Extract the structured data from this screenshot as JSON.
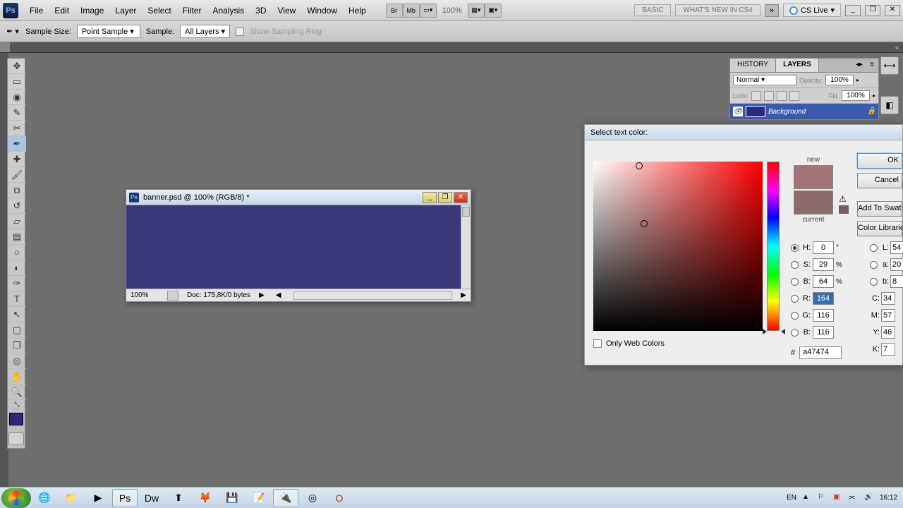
{
  "menubar": {
    "items": [
      "File",
      "Edit",
      "Image",
      "Layer",
      "Select",
      "Filter",
      "Analysis",
      "3D",
      "View",
      "Window",
      "Help"
    ],
    "zoom_pct": "100%",
    "workspace_basic": "BASIC",
    "workspace_whatsnew": "WHAT'S NEW IN CS4",
    "cslive": "CS Live"
  },
  "optbar": {
    "sample_size_label": "Sample Size:",
    "sample_size_value": "Point Sample",
    "sample_label": "Sample:",
    "sample_value": "All Layers",
    "show_ring": "Show Sampling Ring"
  },
  "document": {
    "title": "banner.psd @ 100% (RGB/8) *",
    "zoom": "100%",
    "docinfo": "Doc: 175,8K/0 bytes"
  },
  "layers_panel": {
    "tab_history": "HISTORY",
    "tab_layers": "LAYERS",
    "blend": "Normal",
    "opacity_label": "Opacity:",
    "opacity": "100%",
    "lock_label": "Lock:",
    "fill_label": "Fill:",
    "fill": "100%",
    "layer_name": "Background"
  },
  "picker": {
    "title": "Select text color:",
    "new_label": "new",
    "current_label": "current",
    "ok": "OK",
    "cancel": "Cancel",
    "add_swatch": "Add To Swatches",
    "color_lib": "Color Libraries",
    "H": "0",
    "H_unit": "°",
    "S": "29",
    "S_unit": "%",
    "Bv": "64",
    "Bv_unit": "%",
    "R": "164",
    "G": "116",
    "B": "116",
    "L": "54",
    "a": "20",
    "b2": "8",
    "C": "34",
    "M": "57",
    "Y": "46",
    "K": "7",
    "hex_label": "#",
    "hex": "a47474",
    "webonly": "Only Web Colors"
  },
  "taskbar": {
    "lang": "EN",
    "time": "16:12"
  }
}
